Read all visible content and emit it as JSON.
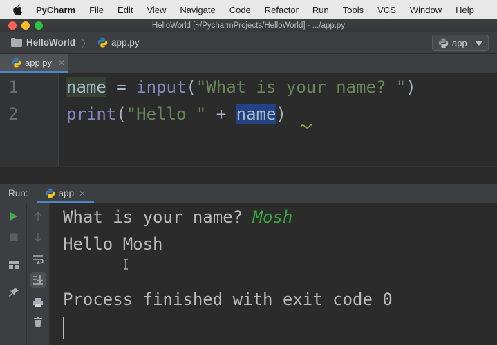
{
  "menubar": {
    "app_name": "PyCharm",
    "items": [
      "File",
      "Edit",
      "View",
      "Navigate",
      "Code",
      "Refactor",
      "Run",
      "Tools",
      "VCS",
      "Window",
      "Help"
    ]
  },
  "window": {
    "title": "HelloWorld [~/PycharmProjects/HelloWorld] - .../app.py"
  },
  "navbar": {
    "project": "HelloWorld",
    "file": "app.py",
    "run_config": "app"
  },
  "editor": {
    "active_tab": "app.py",
    "line_numbers": [
      "1",
      "2"
    ],
    "line1": {
      "var": "name",
      "assign": " = ",
      "func": "input",
      "open": "(",
      "string": "\"What is your name? \"",
      "close": ")"
    },
    "line2": {
      "func": "print",
      "open": "(",
      "string": "\"Hello \"",
      "plus": " + ",
      "var": "name",
      "close": ")"
    }
  },
  "run_panel": {
    "label": "Run:",
    "tab": "app",
    "prompt": "What is your name? ",
    "user_input": "Mosh",
    "output": "Hello Mosh",
    "exit_message": "Process finished with exit code 0"
  },
  "colors": {
    "accent": "#4a88c7",
    "string": "#6a8759",
    "builtin": "#8888c6",
    "console_input": "#3aa640",
    "selection": "#214283"
  }
}
